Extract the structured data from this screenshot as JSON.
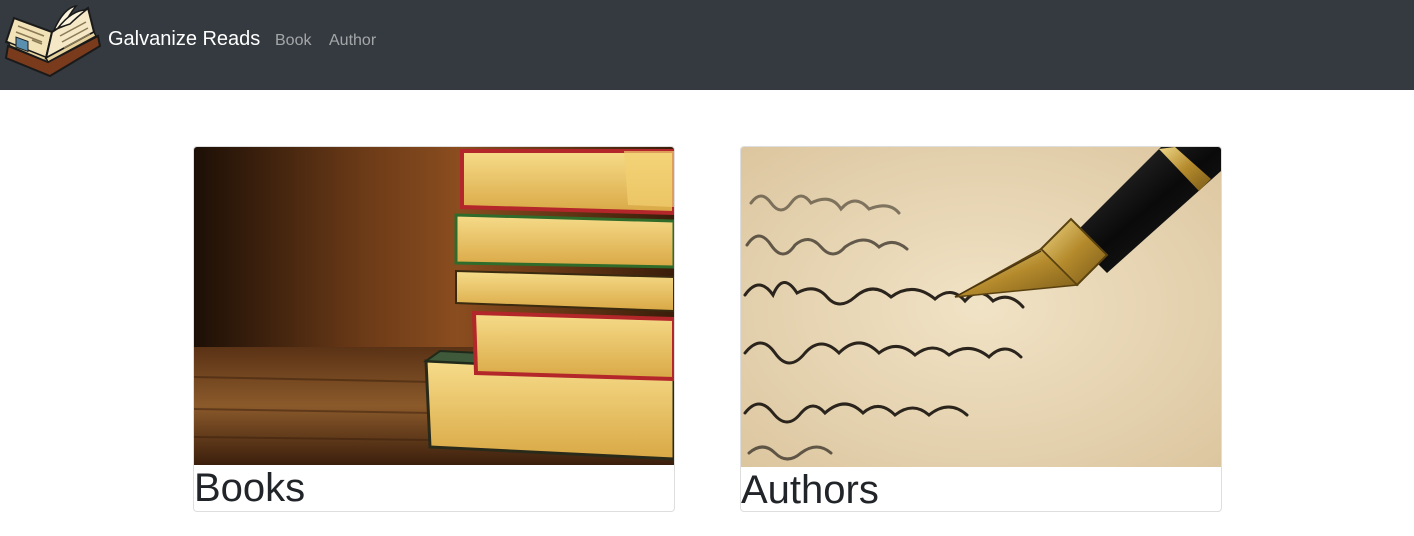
{
  "navbar": {
    "brand": "Galvanize Reads",
    "brand_logo_icon": "open-book-icon",
    "links": [
      "Book",
      "Author"
    ]
  },
  "cards": [
    {
      "title": "Books",
      "image": "stacked-books-photo"
    },
    {
      "title": "Authors",
      "image": "fountain-pen-handwriting-photo"
    }
  ],
  "colors": {
    "navbar_bg": "#343a40",
    "brand_text": "#ffffff",
    "nav_link": "#9a9da0"
  }
}
